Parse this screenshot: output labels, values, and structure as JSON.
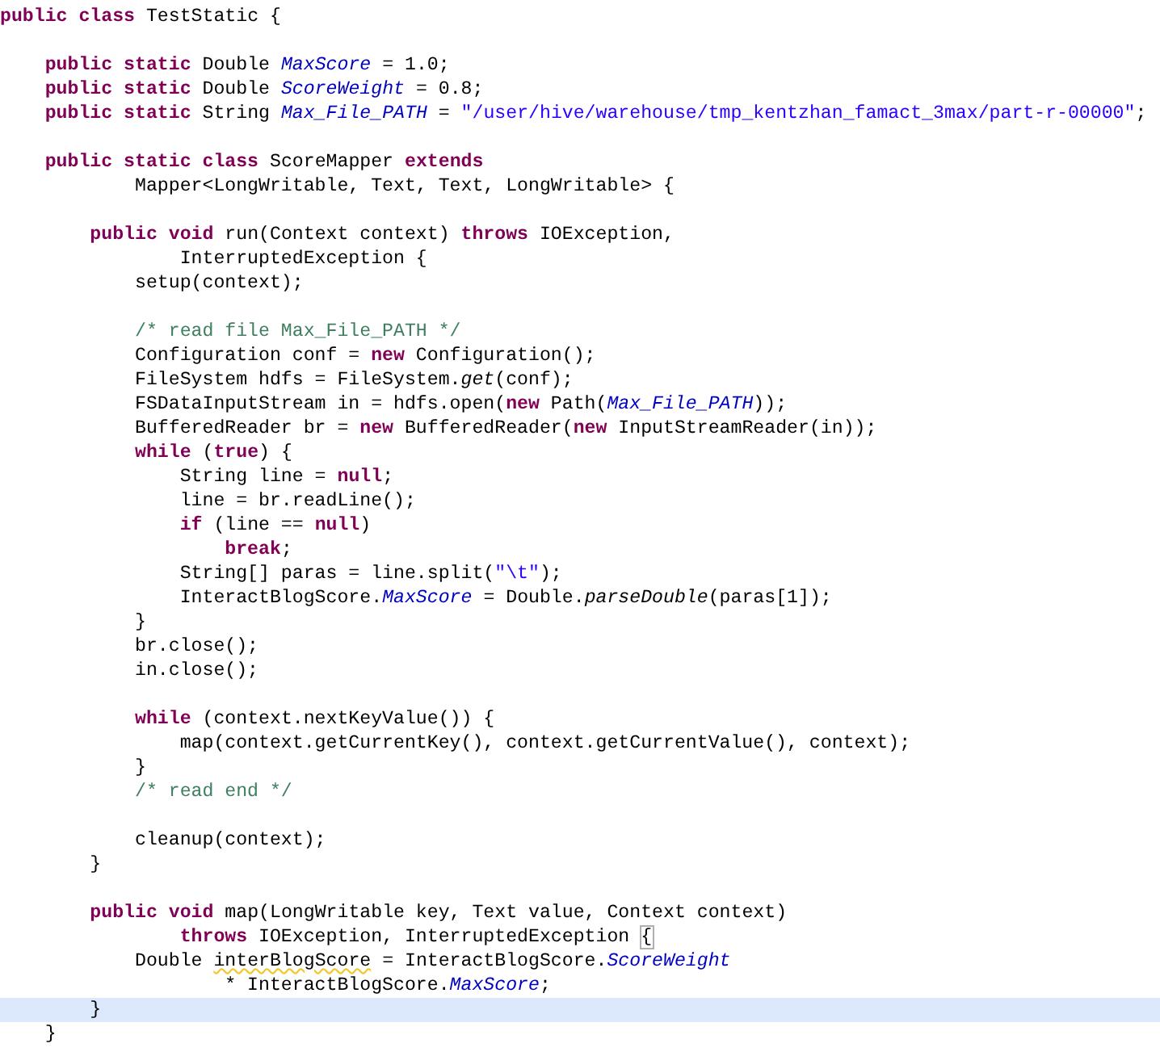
{
  "editor": {
    "lines": [
      {
        "current": false,
        "segments": [
          {
            "kind": "keyword",
            "text": "public class"
          },
          {
            "kind": "plain",
            "text": " TestStatic {"
          }
        ]
      },
      {
        "current": false
      },
      {
        "current": false,
        "segments": [
          {
            "kind": "keyword",
            "text": "    public static"
          },
          {
            "kind": "plain",
            "text": " Double "
          },
          {
            "kind": "field",
            "text": "MaxScore"
          },
          {
            "kind": "plain",
            "text": " = 1.0;"
          }
        ]
      },
      {
        "current": false,
        "segments": [
          {
            "kind": "keyword",
            "text": "    public static"
          },
          {
            "kind": "plain",
            "text": " Double "
          },
          {
            "kind": "field",
            "text": "ScoreWeight"
          },
          {
            "kind": "plain",
            "text": " = 0.8;"
          }
        ]
      },
      {
        "current": false,
        "segments": [
          {
            "kind": "keyword",
            "text": "    public static"
          },
          {
            "kind": "plain",
            "text": " String "
          },
          {
            "kind": "field",
            "text": "Max_File_PATH"
          },
          {
            "kind": "plain",
            "text": " = "
          },
          {
            "kind": "string",
            "text": "\"/user/hive/warehouse/tmp_kentzhan_famact_3max/part-r-00000\""
          },
          {
            "kind": "plain",
            "text": ";"
          }
        ]
      },
      {
        "current": false
      },
      {
        "current": false,
        "segments": [
          {
            "kind": "keyword",
            "text": "    public static class"
          },
          {
            "kind": "plain",
            "text": " ScoreMapper "
          },
          {
            "kind": "keyword",
            "text": "extends"
          }
        ]
      },
      {
        "current": false,
        "segments": [
          {
            "kind": "plain",
            "text": "            Mapper<LongWritable, Text, Text, LongWritable> {"
          }
        ]
      },
      {
        "current": false
      },
      {
        "current": false,
        "segments": [
          {
            "kind": "keyword",
            "text": "        public void"
          },
          {
            "kind": "plain",
            "text": " run(Context context) "
          },
          {
            "kind": "keyword",
            "text": "throws"
          },
          {
            "kind": "plain",
            "text": " IOException,"
          }
        ]
      },
      {
        "current": false,
        "segments": [
          {
            "kind": "plain",
            "text": "                InterruptedException {"
          }
        ]
      },
      {
        "current": false,
        "segments": [
          {
            "kind": "plain",
            "text": "            setup(context);"
          }
        ]
      },
      {
        "current": false
      },
      {
        "current": false,
        "segments": [
          {
            "kind": "comment",
            "text": "            /* read file Max_File_PATH */"
          }
        ]
      },
      {
        "current": false,
        "segments": [
          {
            "kind": "plain",
            "text": "            Configuration conf = "
          },
          {
            "kind": "keyword",
            "text": "new"
          },
          {
            "kind": "plain",
            "text": " Configuration();"
          }
        ]
      },
      {
        "current": false,
        "segments": [
          {
            "kind": "plain",
            "text": "            FileSystem hdfs = FileSystem."
          },
          {
            "kind": "static_method",
            "text": "get"
          },
          {
            "kind": "plain",
            "text": "(conf);"
          }
        ]
      },
      {
        "current": false,
        "segments": [
          {
            "kind": "plain",
            "text": "            FSDataInputStream in = hdfs.open("
          },
          {
            "kind": "keyword",
            "text": "new"
          },
          {
            "kind": "plain",
            "text": " Path("
          },
          {
            "kind": "field",
            "text": "Max_File_PATH"
          },
          {
            "kind": "plain",
            "text": "));"
          }
        ]
      },
      {
        "current": false,
        "segments": [
          {
            "kind": "plain",
            "text": "            BufferedReader br = "
          },
          {
            "kind": "keyword",
            "text": "new"
          },
          {
            "kind": "plain",
            "text": " BufferedReader("
          },
          {
            "kind": "keyword",
            "text": "new"
          },
          {
            "kind": "plain",
            "text": " InputStreamReader(in));"
          }
        ]
      },
      {
        "current": false,
        "segments": [
          {
            "kind": "keyword",
            "text": "            while"
          },
          {
            "kind": "plain",
            "text": " ("
          },
          {
            "kind": "keyword",
            "text": "true"
          },
          {
            "kind": "plain",
            "text": ") {"
          }
        ]
      },
      {
        "current": false,
        "segments": [
          {
            "kind": "plain",
            "text": "                String line = "
          },
          {
            "kind": "keyword",
            "text": "null"
          },
          {
            "kind": "plain",
            "text": ";"
          }
        ]
      },
      {
        "current": false,
        "segments": [
          {
            "kind": "plain",
            "text": "                line = br.readLine();"
          }
        ]
      },
      {
        "current": false,
        "segments": [
          {
            "kind": "keyword",
            "text": "                if"
          },
          {
            "kind": "plain",
            "text": " (line == "
          },
          {
            "kind": "keyword",
            "text": "null"
          },
          {
            "kind": "plain",
            "text": ")"
          }
        ]
      },
      {
        "current": false,
        "segments": [
          {
            "kind": "keyword",
            "text": "                    break"
          },
          {
            "kind": "plain",
            "text": ";"
          }
        ]
      },
      {
        "current": false,
        "segments": [
          {
            "kind": "plain",
            "text": "                String[] paras = line.split("
          },
          {
            "kind": "string",
            "text": "\"\\t\""
          },
          {
            "kind": "plain",
            "text": ");"
          }
        ]
      },
      {
        "current": false,
        "segments": [
          {
            "kind": "plain",
            "text": "                InteractBlogScore."
          },
          {
            "kind": "field",
            "text": "MaxScore"
          },
          {
            "kind": "plain",
            "text": " = Double."
          },
          {
            "kind": "static_method",
            "text": "parseDouble"
          },
          {
            "kind": "plain",
            "text": "(paras[1]);"
          }
        ]
      },
      {
        "current": false,
        "segments": [
          {
            "kind": "plain",
            "text": "            }"
          }
        ]
      },
      {
        "current": false,
        "segments": [
          {
            "kind": "plain",
            "text": "            br.close();"
          }
        ]
      },
      {
        "current": false,
        "segments": [
          {
            "kind": "plain",
            "text": "            in.close();"
          }
        ]
      },
      {
        "current": false
      },
      {
        "current": false,
        "segments": [
          {
            "kind": "keyword",
            "text": "            while"
          },
          {
            "kind": "plain",
            "text": " (context.nextKeyValue()) {"
          }
        ]
      },
      {
        "current": false,
        "segments": [
          {
            "kind": "plain",
            "text": "                map(context.getCurrentKey(), context.getCurrentValue(), context);"
          }
        ]
      },
      {
        "current": false,
        "segments": [
          {
            "kind": "plain",
            "text": "            }"
          }
        ]
      },
      {
        "current": false,
        "segments": [
          {
            "kind": "comment",
            "text": "            /* read end */"
          }
        ]
      },
      {
        "current": false
      },
      {
        "current": false,
        "segments": [
          {
            "kind": "plain",
            "text": "            cleanup(context);"
          }
        ]
      },
      {
        "current": false,
        "segments": [
          {
            "kind": "plain",
            "text": "        }"
          }
        ]
      },
      {
        "current": false
      },
      {
        "current": false,
        "segments": [
          {
            "kind": "keyword",
            "text": "        public void"
          },
          {
            "kind": "plain",
            "text": " map(LongWritable key, Text value, Context context)"
          }
        ]
      },
      {
        "current": false,
        "segments": [
          {
            "kind": "keyword",
            "text": "                throws"
          },
          {
            "kind": "plain",
            "text": " IOException, InterruptedException "
          },
          {
            "kind": "bracket_match",
            "text": "{"
          }
        ]
      },
      {
        "current": false,
        "segments": [
          {
            "kind": "plain",
            "text": "            Double "
          },
          {
            "kind": "warning",
            "text": "interBlogScore"
          },
          {
            "kind": "plain",
            "text": " = InteractBlogScore."
          },
          {
            "kind": "field",
            "text": "ScoreWeight"
          }
        ]
      },
      {
        "current": false,
        "segments": [
          {
            "kind": "plain",
            "text": "                    * InteractBlogScore."
          },
          {
            "kind": "field",
            "text": "MaxScore"
          },
          {
            "kind": "plain",
            "text": ";"
          }
        ]
      },
      {
        "current": true,
        "segments": [
          {
            "kind": "plain",
            "text": "        }"
          }
        ]
      },
      {
        "current": false,
        "segments": [
          {
            "kind": "plain",
            "text": "    }"
          }
        ]
      }
    ]
  }
}
